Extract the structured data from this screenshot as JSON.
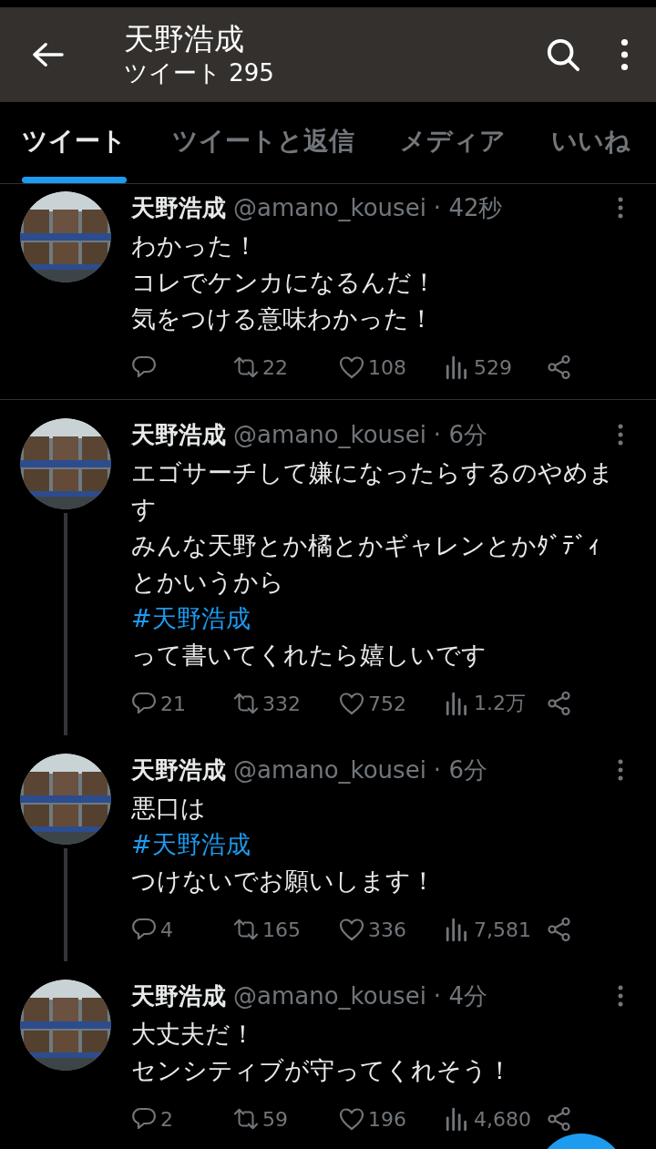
{
  "header": {
    "title": "天野浩成",
    "subtitle": "ツイート 295"
  },
  "tabs": [
    {
      "label": "ツイート",
      "selected": true
    },
    {
      "label": "ツイートと返信",
      "selected": false
    },
    {
      "label": "メディア",
      "selected": false
    },
    {
      "label": "いいね",
      "selected": false
    }
  ],
  "tweets": [
    {
      "name": "天野浩成",
      "handle": "@amano_kousei",
      "time": "· 42秒",
      "thread_next": false,
      "divider": true,
      "lines": [
        {
          "kind": "text",
          "text": "わかった！"
        },
        {
          "kind": "text",
          "text": "コレでケンカになるんだ！"
        },
        {
          "kind": "text",
          "text": "気をつける意味わかった！"
        }
      ],
      "retweets": "22",
      "likes": "108",
      "views": "529"
    },
    {
      "name": "天野浩成",
      "handle": "@amano_kousei",
      "time": "· 6分",
      "thread_next": true,
      "divider": false,
      "lines": [
        {
          "kind": "text",
          "text": "エゴサーチして嫌になったらするのやめま"
        },
        {
          "kind": "text",
          "text": "す"
        },
        {
          "kind": "text",
          "text": "みんな天野とか橘とかギャレンとかﾀﾞﾃﾞｨ"
        },
        {
          "kind": "text",
          "text": "とかいうから"
        },
        {
          "kind": "hashtag",
          "text": "#天野浩成"
        },
        {
          "kind": "text",
          "text": "って書いてくれたら嬉しいです"
        }
      ],
      "replies": "21",
      "retweets": "332",
      "likes": "752",
      "views": "1.2万"
    },
    {
      "name": "天野浩成",
      "handle": "@amano_kousei",
      "time": "· 6分",
      "thread_next": true,
      "divider": false,
      "lines": [
        {
          "kind": "text",
          "text": "悪口は"
        },
        {
          "kind": "hashtag",
          "text": "#天野浩成"
        },
        {
          "kind": "text",
          "text": "つけないでお願いします！"
        }
      ],
      "replies": "4",
      "retweets": "165",
      "likes": "336",
      "views": "7,581"
    },
    {
      "name": "天野浩成",
      "handle": "@amano_kousei",
      "time": "· 4分",
      "thread_next": false,
      "divider": false,
      "lines": [
        {
          "kind": "text",
          "text": "大丈夫だ！"
        },
        {
          "kind": "text",
          "text": "センシティブが守ってくれそう！"
        }
      ],
      "replies": "2",
      "retweets": "59",
      "likes": "196",
      "views": "4,680"
    }
  ]
}
